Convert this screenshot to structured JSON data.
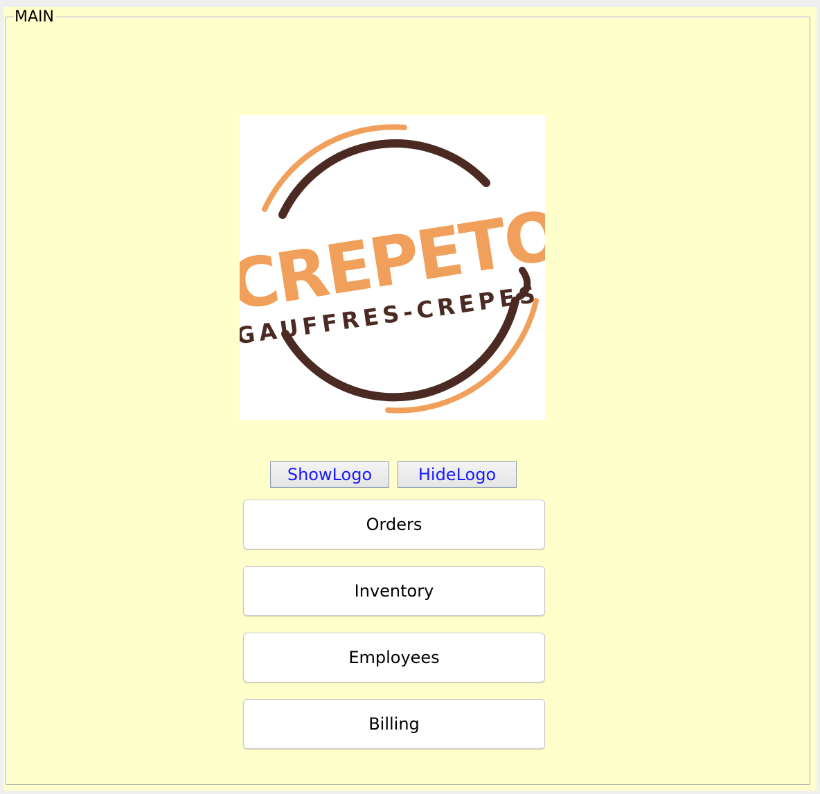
{
  "panel": {
    "title": "MAIN",
    "background": "#ffffcc"
  },
  "logo": {
    "brand_text": "CREPETO",
    "tagline": "GAUFFRES-CREPES",
    "colors": {
      "orange": "#f0a05a",
      "brown": "#4a2a22"
    }
  },
  "logo_controls": {
    "show_label": "ShowLogo",
    "hide_label": "HideLogo",
    "link_color": "#1a1aff"
  },
  "menu": {
    "orders_label": "Orders",
    "inventory_label": "Inventory",
    "employees_label": "Employees",
    "billing_label": "Billing"
  }
}
